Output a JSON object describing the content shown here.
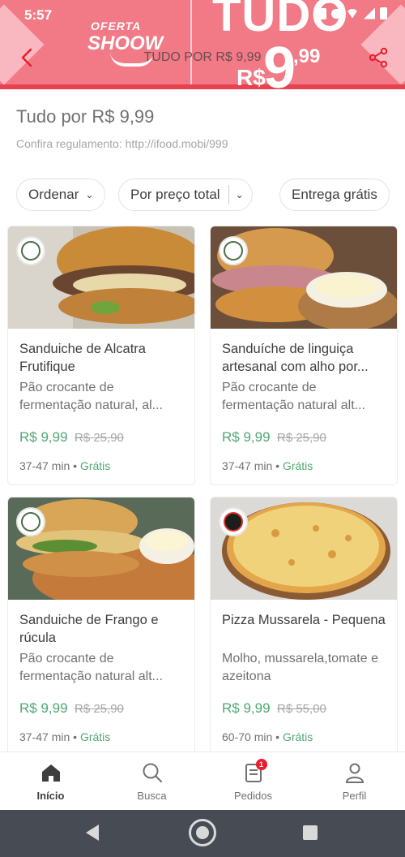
{
  "status_bar": {
    "time": "5:57"
  },
  "banner": {
    "oferta": "OFERTA",
    "shoow": "SHOOW",
    "tudo": "TUDO",
    "por": "POR",
    "rs": "R$",
    "nine": "9",
    "cents": ",99"
  },
  "header": {
    "title": "TUDO POR R$ 9,99"
  },
  "page": {
    "title": "Tudo por R$ 9,99",
    "subtitle": "Confira regulamento: http://ifood.mobi/999"
  },
  "filters": {
    "sort_label": "Ordenar",
    "price_label": "Por preço total",
    "delivery_label": "Entrega grátis"
  },
  "products": [
    {
      "name": "Sanduiche de Alcatra Frutifique",
      "description": "Pão crocante de fermentação natural, al...",
      "price": "R$ 9,99",
      "old_price": "R$ 25,90",
      "delivery_time": "37-47 min",
      "delivery_fee": "Grátis"
    },
    {
      "name": "Sanduíche de linguiça artesanal com alho por...",
      "description": "Pão crocante de fermentação natural alt...",
      "price": "R$ 9,99",
      "old_price": "R$ 25,90",
      "delivery_time": "37-47 min",
      "delivery_fee": "Grátis"
    },
    {
      "name": "Sanduiche de Frango e rúcula",
      "description": "Pão crocante de fermentação natural alt...",
      "price": "R$ 9,99",
      "old_price": "R$ 25,90",
      "delivery_time": "37-47 min",
      "delivery_fee": "Grátis"
    },
    {
      "name": "Pizza Mussarela - Pequena",
      "description": "Molho, mussarela,tomate e azeitona",
      "price": "R$ 9,99",
      "old_price": "R$ 55,00",
      "delivery_time": "60-70 min",
      "delivery_fee": "Grátis"
    }
  ],
  "bottom_nav": {
    "items": [
      {
        "label": "Início",
        "icon": "home-icon"
      },
      {
        "label": "Busca",
        "icon": "search-icon"
      },
      {
        "label": "Pedidos",
        "icon": "orders-icon",
        "badge": "1"
      },
      {
        "label": "Perfil",
        "icon": "profile-icon"
      }
    ]
  },
  "colors": {
    "accent": "#ea1d2c",
    "banner": "#f27a86",
    "price_green": "#50a773",
    "system_nav": "#464b54"
  }
}
